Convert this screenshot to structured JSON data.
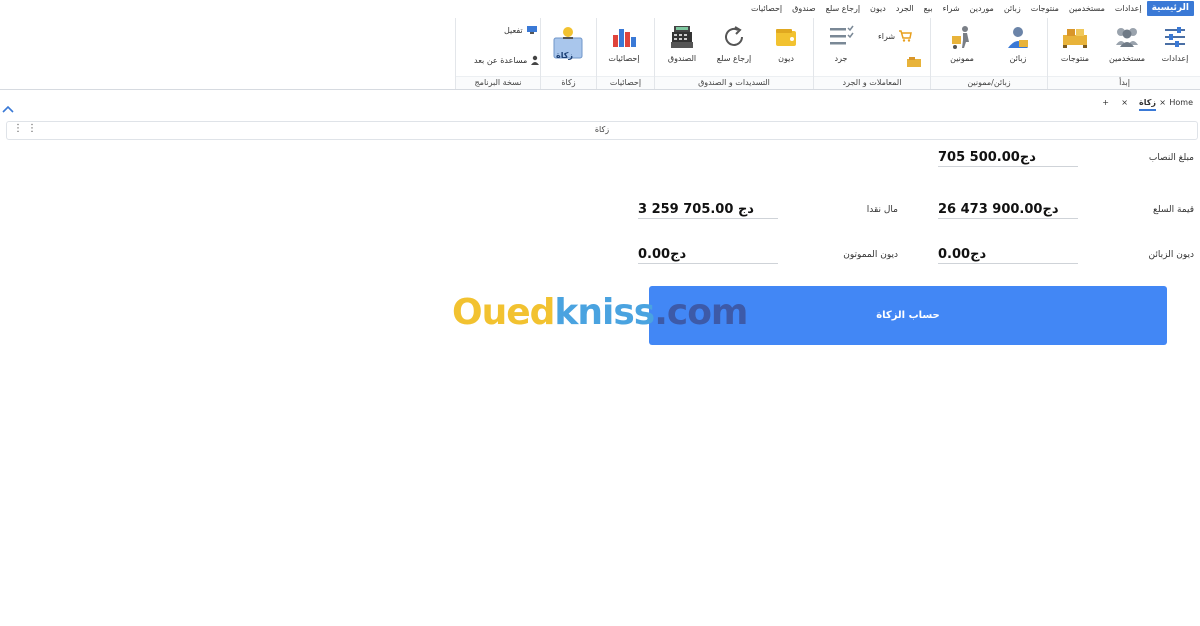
{
  "menu": [
    "الرئيسية",
    "إعدادات",
    "مستخدمين",
    "منتوجات",
    "زبائن",
    "موردين",
    "شراء",
    "بيع",
    "الجرد",
    "ديون",
    "إرجاع سلع",
    "صندوق",
    "إحصائيات"
  ],
  "ribbon": {
    "settings": "إعدادات",
    "users": "مستخدمين",
    "products": "منتوجات",
    "customers": "زبائن",
    "suppliers": "ممونين",
    "inventory": "جرد",
    "purchase": "شراء",
    "debts": "ديون",
    "return_goods": "إرجاع سلع",
    "cashbox": "الصندوق",
    "statistics": "إحصائيات",
    "zakat": "زكاة",
    "activate": "تفعيل",
    "remote_help": "مساعدة عن بعد",
    "groups": {
      "start": "إبدأ",
      "customers_suppliers": "زبائن/ممونين",
      "transactions": "المعاملات و الجرد",
      "payments_cashbox": "التسديدات و الصندوق",
      "statistics": "إحصائيات",
      "zakat": "زكاة",
      "program_copy": "نسخة البرنامج"
    }
  },
  "tabs": {
    "home": "Home",
    "active": "زكاة",
    "close": "×",
    "add": "+"
  },
  "section_title": "زكاة",
  "form": {
    "nisab_label": "مبلغ النصاب",
    "nisab_value": "705 500.00دج",
    "goods_label": "قيمة السلع",
    "goods_value": "26 473 900.00دج",
    "cash_label": "مال نقدا",
    "cash_value": "3 259 705.00 دج",
    "customers_debts_label": "ديون الزبائن",
    "customers_debts_value": "0.00دج",
    "suppliers_debts_label": "ديون المموتون",
    "suppliers_debts_value": "0.00دج"
  },
  "calc_button": "حساب الزكاة",
  "watermark": {
    "part1": "Oued",
    "part2": "kniss",
    "part3": ".com"
  },
  "colors": {
    "accent": "#4287f5",
    "menu_active": "#3a79d6"
  }
}
